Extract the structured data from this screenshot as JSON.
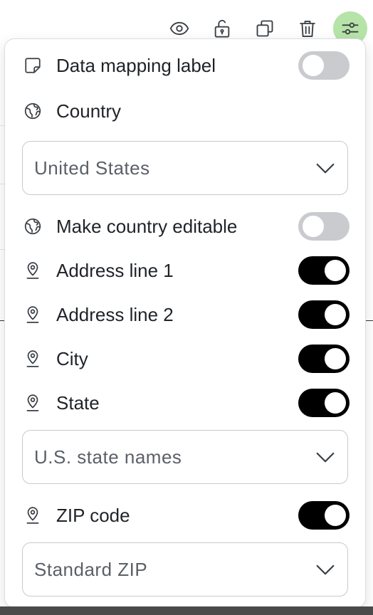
{
  "toolbar": {
    "icons": [
      "eye-icon",
      "unlock-icon",
      "copy-icon",
      "trash-icon",
      "sliders-icon"
    ],
    "active_color": "#b6e3a8"
  },
  "panel": {
    "data_mapping": {
      "label": "Data mapping label",
      "enabled": false
    },
    "country": {
      "label": "Country",
      "selected": "United States"
    },
    "make_country_editable": {
      "label": "Make country editable",
      "enabled": false
    },
    "address_line_1": {
      "label": "Address line 1",
      "enabled": true
    },
    "address_line_2": {
      "label": "Address line 2",
      "enabled": true
    },
    "city": {
      "label": "City",
      "enabled": true
    },
    "state": {
      "label": "State",
      "enabled": true,
      "format": "U.S. state names"
    },
    "zip": {
      "label": "ZIP code",
      "enabled": true,
      "format": "Standard ZIP"
    }
  },
  "colors": {
    "toggle_on": "#000000",
    "toggle_off": "#c9cbcf",
    "border": "#c7c9cd"
  }
}
